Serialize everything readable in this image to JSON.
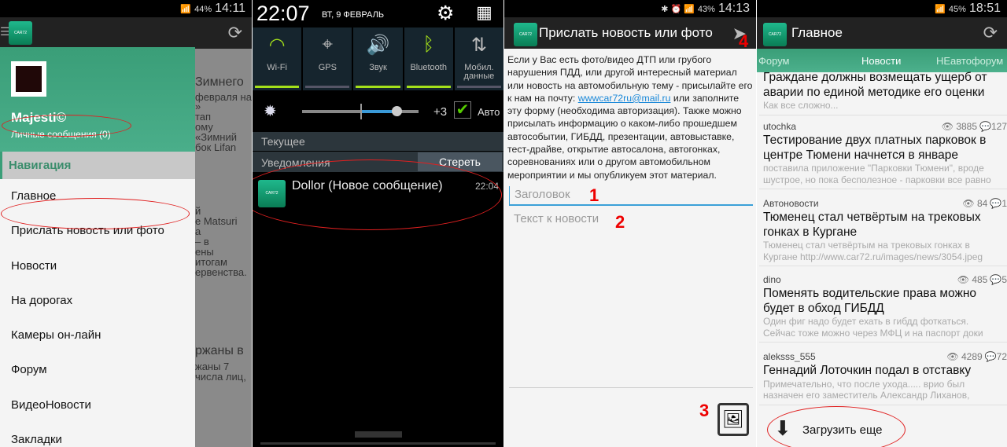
{
  "p1": {
    "time": "14:11",
    "battery": "44%",
    "user": "Majesti©",
    "messages": "Личные сообщения (0)",
    "nav_header": "Навигация",
    "nav": [
      "Главное",
      "Прислать новость или фото",
      "Новости",
      "На дорогах",
      "Камеры он-лайн",
      "Форум",
      "ВидеоНовости",
      "Закладки"
    ],
    "behind": [
      "Зимнего",
      "февраля на",
      "»",
      "тап",
      "ому",
      "«Зимний",
      "бок Lifan",
      "й",
      "e Matsuri",
      "а",
      "– в",
      "ены",
      "итогам",
      "ервенства.",
      "ржаны в",
      "жаны 7",
      "числа лиц,"
    ]
  },
  "p2": {
    "time": "22:07",
    "date": "ВТ, 9 ФЕВРАЛЬ",
    "toggles": [
      {
        "label": "Wi-Fi",
        "on": true,
        "icon": "wifi-icon"
      },
      {
        "label": "GPS",
        "on": false,
        "icon": "gps-icon"
      },
      {
        "label": "Звук",
        "on": true,
        "icon": "sound-icon"
      },
      {
        "label": "Bluetooth",
        "on": true,
        "icon": "bluetooth-icon"
      },
      {
        "label": "Мобил. данные",
        "on": false,
        "icon": "mobile-data-icon"
      }
    ],
    "brightness": "+3",
    "auto": "Авто",
    "auto_checked": true,
    "current": "Текущее",
    "notifications": "Уведомления",
    "clear": "Стереть",
    "notif_title": "Dollor (Новое сообщение)",
    "notif_time": "22:04"
  },
  "p3": {
    "time": "14:13",
    "battery": "43%",
    "title": "Прислать новость или фото",
    "desc_before": "Если у Вас есть фото/видео ДТП или грубого нарушения ПДД, или другой интересный материал или новость на автомобильную тему - присылайте его к нам на почту: ",
    "email": "wwwcar72ru@mail.ru",
    "desc_after": " или заполните эту форму (необходима авторизация). Также можно присылать информацию о каком-либо прошедшем автособытии, ГИБДД, презентации, автовыставке, тест-драйве, открытие автосалона, автогонках, соревнованиях или о другом автомобильном мероприятии и мы опубликуем этот материал.",
    "title_placeholder": "Заголовок",
    "text_placeholder": "Текст к новости",
    "marks": [
      "1",
      "2",
      "3",
      "4"
    ]
  },
  "p4": {
    "time": "18:51",
    "battery": "45%",
    "title": "Главное",
    "tabs": [
      "Форум",
      "Новости",
      "НЕавтофорум"
    ],
    "news": [
      {
        "author": "",
        "views": "",
        "comments": "",
        "title": "Граждане должны возмещать ущерб от аварии по единой методике его оценки",
        "excerpt": "Как все сложно..."
      },
      {
        "author": "utochka",
        "views": "3885",
        "comments": "127",
        "title": "Тестирование двух платных парковок в центре Тюмени начнется в январе",
        "excerpt": "поставила приложение \"Парковки Тюмени\", вроде шустрое, но пока бесполезное - парковки все равно"
      },
      {
        "author": "Автоновости",
        "views": "84",
        "comments": "1",
        "title": "Тюменец стал четвёртым на трековых гонках в Кургане",
        "excerpt": "Тюменец стал четвёртым на трековых гонках в Кургане http://www.car72.ru/images/news/3054.jpeg"
      },
      {
        "author": "dino",
        "views": "485",
        "comments": "5",
        "title": "Поменять водительские права можно будет в обход ГИБДД",
        "excerpt": "Один фиг надо будет ехать в гибдд фоткаться. Сейчас тоже можно через МФЦ и на паспорт доки"
      },
      {
        "author": "aleksss_555",
        "views": "4289",
        "comments": "72",
        "title": "Геннадий Лоточкин подал в отставку",
        "excerpt": "Примечательно, что после ухода..... врио был назначен его заместитель Александр Лиханов,"
      }
    ],
    "load_more": "Загрузить еще"
  },
  "colors": {
    "accent": "#3a9e78",
    "toggle_on": "#a4e01a",
    "annotation": "#e02020",
    "link": "#1a88d8"
  }
}
